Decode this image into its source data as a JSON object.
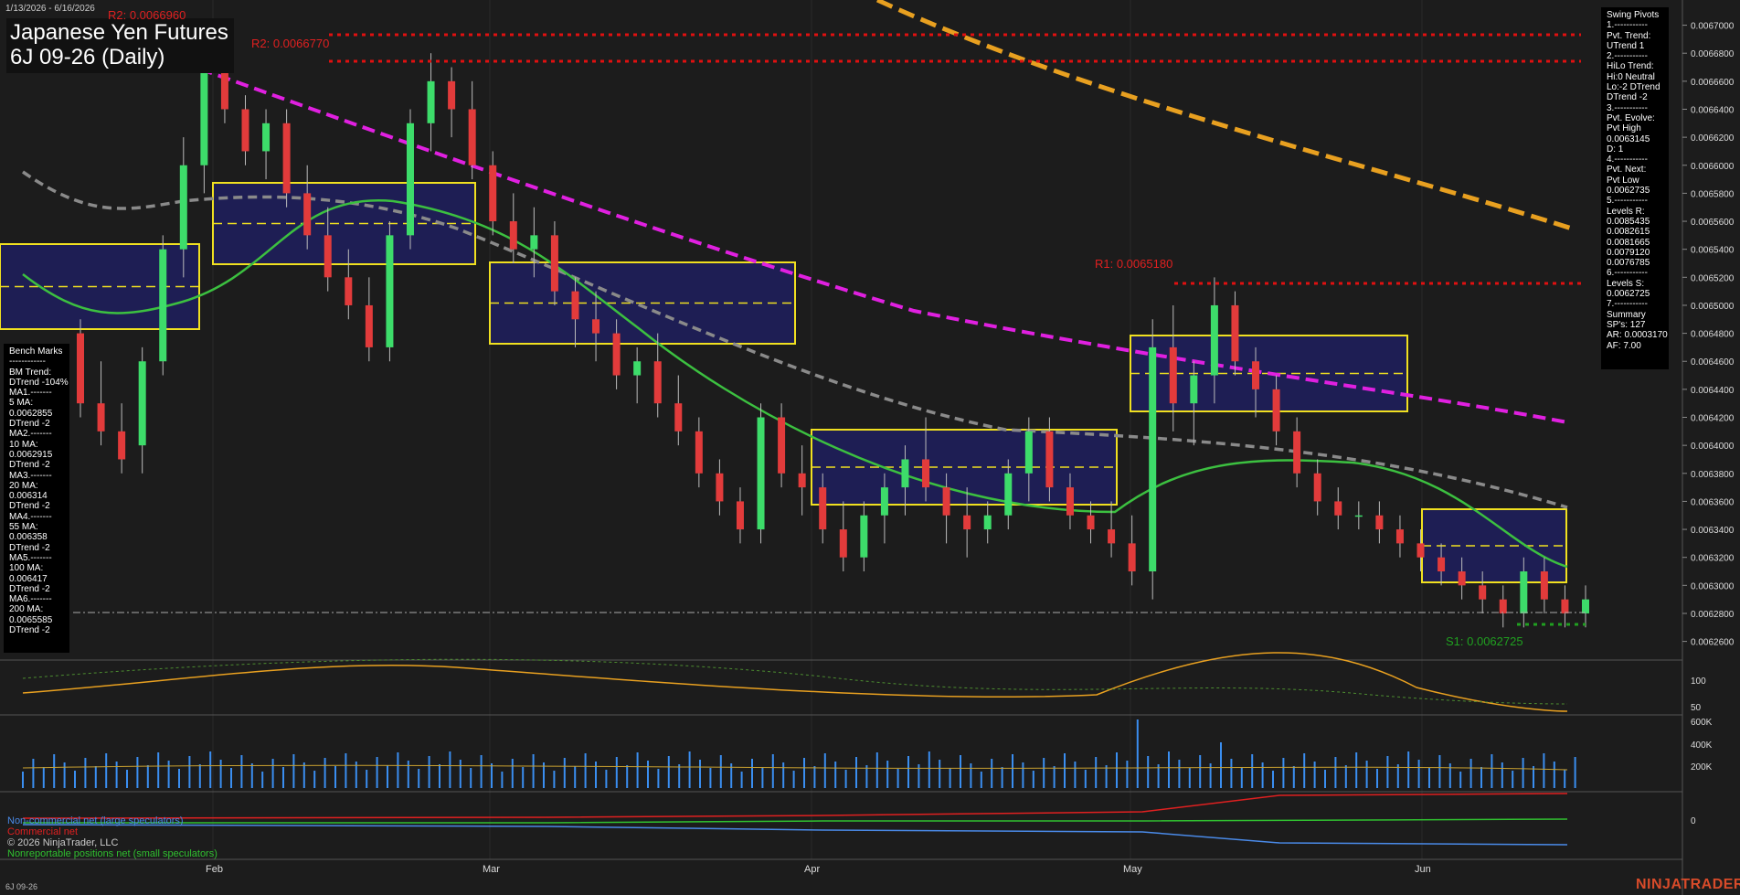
{
  "header": {
    "date_range": "1/13/2026 - 6/16/2026",
    "title_line1": "Japanese Yen Futures",
    "title_line2": "6J 09-26 (Daily)"
  },
  "levels": {
    "r2_top_partial": "R2: 0.0066960",
    "r2": "R2: 0.0066770",
    "r1": "R1: 0.0065180",
    "s1": "S1: 0.0062725"
  },
  "bench_marks": {
    "lines": [
      "Bench Marks",
      "------------",
      "BM Trend:",
      "DTrend -104%",
      "MA1.-------",
      "5 MA:",
      "0.0062855",
      "DTrend -2",
      "MA2.-------",
      "10 MA:",
      "0.0062915",
      "DTrend -2",
      "MA3.-------",
      "20 MA:",
      "0.006314",
      "DTrend -2",
      "MA4.-------",
      "55 MA:",
      "0.006358",
      "DTrend -2",
      "MA5.-------",
      "100 MA:",
      "0.006417",
      "DTrend -2",
      "MA6.-------",
      "200 MA:",
      "0.0065585",
      "DTrend -2"
    ]
  },
  "swing_pivots": {
    "lines": [
      "Swing Pivots",
      "1.-----------",
      "Pvt. Trend:",
      "UTrend 1",
      "2.-----------",
      "HiLo Trend:",
      "Hi:0 Neutral",
      "Lo:-2 DTrend",
      "DTrend -2",
      "3.-----------",
      "Pvt. Evolve:",
      "Pvt High",
      "0.0063145",
      "D: 1",
      "4.-----------",
      "Pvt. Next:",
      "Pvt Low",
      "0.0062735",
      "5.-----------",
      "Levels R:",
      "0.0085435",
      "0.0082615",
      "0.0081665",
      "0.0079120",
      "0.0076785",
      "6.-----------",
      "Levels S:",
      "0.0062725",
      "7.-----------",
      "Summary",
      "SP's: 127",
      "AR: 0.0003170",
      "AF: 7.00"
    ]
  },
  "cot_legend": {
    "noncommercial": "Non-commercial net (large speculators)",
    "commercial": "Commercial net",
    "copyright": "© 2026 NinjaTrader, LLC",
    "nonreportable": "Nonreportable positions net (small speculators)"
  },
  "footer": {
    "symbol": "6J 09-26",
    "brand": "NINJATRADER"
  },
  "colors": {
    "background": "#1c1c1c",
    "up_candle": "#3ddc6a",
    "down_candle": "#e23b3b",
    "zone_fill": "#1e1e5e",
    "zone_border": "#f0e020",
    "magenta_ma": "#e020e0",
    "orange_trend": "#e8a020",
    "gray_ma": "#8a8a8a",
    "green_ma": "#3cc040",
    "resistance": "#e01010",
    "support": "#20a020"
  },
  "chart_data": {
    "type": "candlestick",
    "instrument": "6J 09-26",
    "interval": "Daily",
    "price_axis": [
      "0.0067000",
      "0.0066800",
      "0.0066600",
      "0.0066400",
      "0.0066200",
      "0.0066000",
      "0.0065800",
      "0.0065600",
      "0.0065400",
      "0.0065200",
      "0.0065000",
      "0.0064800",
      "0.0064600",
      "0.0064400",
      "0.0064200",
      "0.0064000",
      "0.0063800",
      "0.0063600",
      "0.0063400",
      "0.0063200",
      "0.0063000",
      "0.0062800",
      "0.0062600"
    ],
    "ylim": [
      0.006248,
      0.006718
    ],
    "x_labels": [
      "Feb",
      "Mar",
      "Apr",
      "May",
      "Jun"
    ],
    "candles": [
      [
        0.00648,
        0.00649,
        0.00642,
        0.00643
      ],
      [
        0.00643,
        0.00646,
        0.0064,
        0.00641
      ],
      [
        0.00641,
        0.00643,
        0.00638,
        0.00639
      ],
      [
        0.0064,
        0.00647,
        0.00638,
        0.00646
      ],
      [
        0.00646,
        0.00655,
        0.00645,
        0.00654
      ],
      [
        0.00654,
        0.00662,
        0.00652,
        0.0066
      ],
      [
        0.0066,
        0.00668,
        0.00658,
        0.00667
      ],
      [
        0.00667,
        0.0067,
        0.00663,
        0.00664
      ],
      [
        0.00664,
        0.00665,
        0.0066,
        0.00661
      ],
      [
        0.00661,
        0.00664,
        0.00659,
        0.00663
      ],
      [
        0.00663,
        0.00664,
        0.00657,
        0.00658
      ],
      [
        0.00658,
        0.0066,
        0.00654,
        0.00655
      ],
      [
        0.00655,
        0.00657,
        0.00651,
        0.00652
      ],
      [
        0.00652,
        0.00654,
        0.00649,
        0.0065
      ],
      [
        0.0065,
        0.00652,
        0.00646,
        0.00647
      ],
      [
        0.00647,
        0.00656,
        0.00646,
        0.00655
      ],
      [
        0.00655,
        0.00664,
        0.00654,
        0.00663
      ],
      [
        0.00663,
        0.00668,
        0.00661,
        0.00666
      ],
      [
        0.00666,
        0.00667,
        0.00662,
        0.00664
      ],
      [
        0.00664,
        0.00666,
        0.00659,
        0.0066
      ],
      [
        0.0066,
        0.00661,
        0.00655,
        0.00656
      ],
      [
        0.00656,
        0.00658,
        0.00653,
        0.00654
      ],
      [
        0.00654,
        0.00657,
        0.00652,
        0.00655
      ],
      [
        0.00655,
        0.00656,
        0.0065,
        0.00651
      ],
      [
        0.00651,
        0.00652,
        0.00647,
        0.00649
      ],
      [
        0.00649,
        0.00651,
        0.00646,
        0.00648
      ],
      [
        0.00648,
        0.00649,
        0.00644,
        0.00645
      ],
      [
        0.00645,
        0.00647,
        0.00643,
        0.00646
      ],
      [
        0.00646,
        0.00648,
        0.00642,
        0.00643
      ],
      [
        0.00643,
        0.00645,
        0.0064,
        0.00641
      ],
      [
        0.00641,
        0.00642,
        0.00637,
        0.00638
      ],
      [
        0.00638,
        0.00639,
        0.00635,
        0.00636
      ],
      [
        0.00636,
        0.00637,
        0.00633,
        0.00634
      ],
      [
        0.00634,
        0.00643,
        0.00633,
        0.00642
      ],
      [
        0.00642,
        0.00643,
        0.00637,
        0.00638
      ],
      [
        0.00638,
        0.0064,
        0.00635,
        0.00637
      ],
      [
        0.00637,
        0.00638,
        0.00633,
        0.00634
      ],
      [
        0.00634,
        0.00636,
        0.00631,
        0.00632
      ],
      [
        0.00632,
        0.00636,
        0.00631,
        0.00635
      ],
      [
        0.00635,
        0.00638,
        0.00633,
        0.00637
      ],
      [
        0.00637,
        0.0064,
        0.00635,
        0.00639
      ],
      [
        0.00639,
        0.00642,
        0.00636,
        0.00637
      ],
      [
        0.00637,
        0.00638,
        0.00633,
        0.00635
      ],
      [
        0.00635,
        0.00637,
        0.00632,
        0.00634
      ],
      [
        0.00634,
        0.00636,
        0.00633,
        0.00635
      ],
      [
        0.00635,
        0.00639,
        0.00634,
        0.00638
      ],
      [
        0.00638,
        0.00642,
        0.00636,
        0.00641
      ],
      [
        0.00641,
        0.00642,
        0.00636,
        0.00637
      ],
      [
        0.00637,
        0.00638,
        0.00634,
        0.00635
      ],
      [
        0.00635,
        0.00636,
        0.00633,
        0.00634
      ],
      [
        0.00634,
        0.00636,
        0.00632,
        0.00633
      ],
      [
        0.00633,
        0.00635,
        0.0063,
        0.00631
      ],
      [
        0.00631,
        0.00649,
        0.00629,
        0.00647
      ],
      [
        0.00647,
        0.0065,
        0.00641,
        0.00643
      ],
      [
        0.00643,
        0.00646,
        0.0064,
        0.00645
      ],
      [
        0.00645,
        0.00652,
        0.00643,
        0.0065
      ],
      [
        0.0065,
        0.00651,
        0.00645,
        0.00646
      ],
      [
        0.00646,
        0.00647,
        0.00642,
        0.00644
      ],
      [
        0.00644,
        0.00645,
        0.0064,
        0.00641
      ],
      [
        0.00641,
        0.00642,
        0.00637,
        0.00638
      ],
      [
        0.00638,
        0.00639,
        0.00635,
        0.00636
      ],
      [
        0.00636,
        0.00637,
        0.00634,
        0.00635
      ],
      [
        0.00635,
        0.00636,
        0.00634,
        0.00635
      ],
      [
        0.00635,
        0.00636,
        0.00633,
        0.00634
      ],
      [
        0.00634,
        0.00635,
        0.00632,
        0.00633
      ],
      [
        0.00633,
        0.00634,
        0.00631,
        0.00632
      ],
      [
        0.00632,
        0.00633,
        0.0063,
        0.00631
      ],
      [
        0.00631,
        0.00632,
        0.00629,
        0.0063
      ],
      [
        0.0063,
        0.00631,
        0.00628,
        0.00629
      ],
      [
        0.00629,
        0.0063,
        0.00627,
        0.00628
      ],
      [
        0.00628,
        0.00632,
        0.00627,
        0.00631
      ],
      [
        0.00631,
        0.00632,
        0.00628,
        0.00629
      ],
      [
        0.00629,
        0.0063,
        0.00627,
        0.00628
      ],
      [
        0.00628,
        0.0063,
        0.00627,
        0.00629
      ]
    ],
    "ma_200": {
      "from": 0.006705,
      "to": 0.006413
    },
    "ma_100": {
      "from": 0.006585,
      "to": 0.006358
    },
    "ma_55_note": "green moving average",
    "resistance_levels": [
      0.006696,
      0.006677,
      0.006518
    ],
    "support_levels": [
      0.0062725
    ],
    "volume_axis": [
      "600K",
      "400K",
      "200K"
    ],
    "oscillator_axis": [
      "100",
      "50"
    ],
    "cot_axis": [
      "0"
    ]
  }
}
